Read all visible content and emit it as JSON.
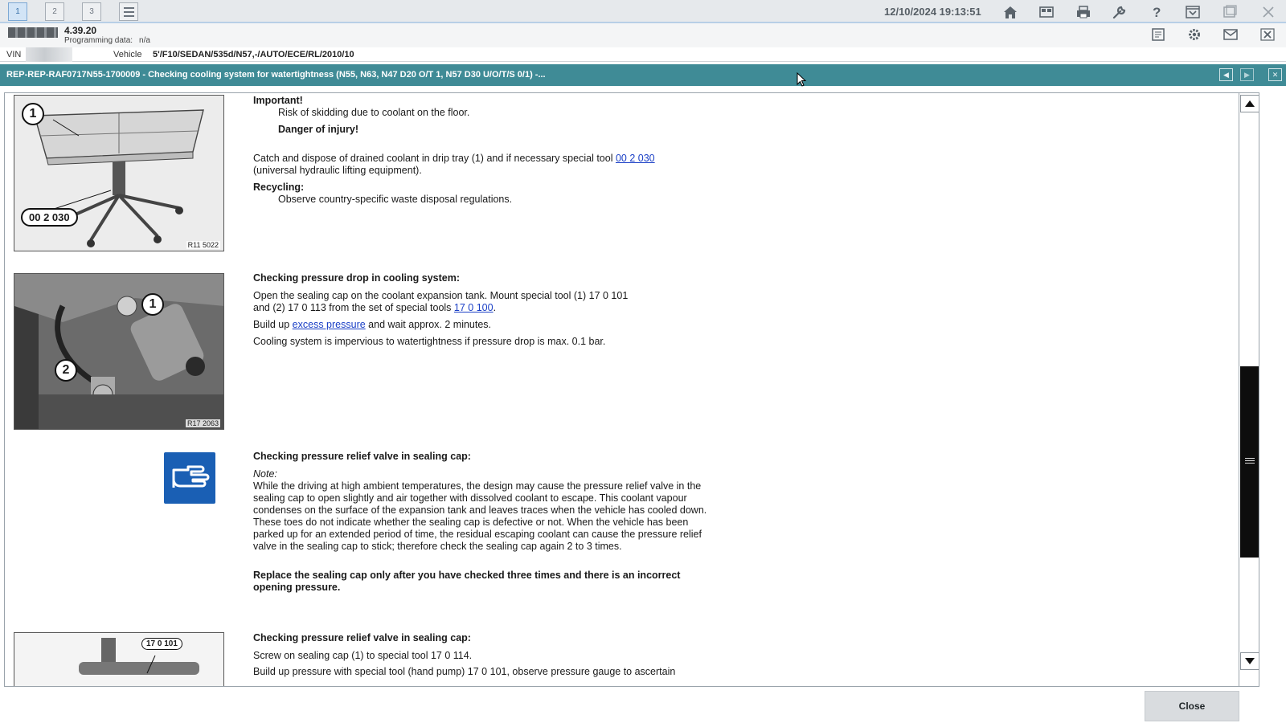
{
  "toolbar": {
    "tabs": [
      "1",
      "2",
      "3"
    ],
    "datetime": "12/10/2024 19:13:51"
  },
  "info": {
    "version": "4.39.20",
    "programming_label": "Programming data:",
    "programming_value": "n/a",
    "vin_label": "VIN",
    "vehicle_label": "Vehicle",
    "vehicle_value": "5'/F10/SEDAN/535d/N57,-/AUTO/ECE/RL/2010/10"
  },
  "document": {
    "title": "REP-REP-RAF0717N55-1700009 - Checking cooling system for watertightness (N55, N63, N47 D20 O/T 1, N57 D30 U/O/T/S 0/1) -...",
    "section1": {
      "important": "Important!",
      "risk": "Risk of skidding due to coolant on the floor.",
      "danger": "Danger of injury!",
      "catch_before": "Catch and dispose of drained coolant in drip tray (1) and if necessary special tool",
      "catch_link": "00 2 030",
      "catch_after": "(universal hydraulic lifting equipment).",
      "recycling": "Recycling:",
      "observe": "Observe country-specific waste disposal regulations.",
      "figure_code": "R11 5022",
      "callout_1": "1",
      "tool_label": "00 2 030"
    },
    "section2": {
      "heading": "Checking pressure drop in cooling system:",
      "line1": "Open the sealing cap on the coolant expansion tank. Mount special tool (1) 17 0 101",
      "line2_before": "and (2) 17 0 113  from the set of special tools",
      "line2_link": "17 0 100",
      "line2_after": ".",
      "line3_before": "Build up",
      "line3_link": "excess pressure",
      "line3_after": "and wait approx. 2 minutes.",
      "line4": "Cooling system is impervious to watertightness if pressure drop is max. 0.1 bar.",
      "figure_code": "R17 2063",
      "callout_1": "1",
      "callout_2": "2"
    },
    "section3": {
      "heading": "Checking pressure relief valve in sealing cap:",
      "note_label": "Note:",
      "note_text": "While the driving at high ambient temperatures, the design may cause the pressure relief valve in the sealing cap to open slightly and air together with dissolved coolant to escape. This coolant vapour condenses on the surface of the expansion tank and leaves traces when the vehicle has cooled down. These toes do not indicate whether the sealing cap is defective or not. When the vehicle has been parked up for an extended period of time, the residual escaping coolant can cause the pressure relief valve in the sealing cap to stick; therefore check the sealing cap again 2 to 3 times.",
      "replace": "Replace the sealing cap only after you have checked three times and there is an incorrect opening pressure."
    },
    "section4": {
      "heading": "Checking pressure relief valve in sealing cap:",
      "line1": "Screw on sealing cap (1) to special tool 17 0 114.",
      "line2": "Build up pressure with special tool (hand pump) 17 0 101, observe pressure gauge to ascertain",
      "tool_label": "17 0 101"
    }
  },
  "footer": {
    "close_label": "Close"
  },
  "icons": {
    "note": "pointing-hand-icon",
    "home": "home-icon",
    "help": "help-icon",
    "settings": "gear-icon",
    "tools": "wrench-icon"
  },
  "colors": {
    "titlebar": "#3f8b96",
    "link": "#1a3fc6",
    "note_icon": "#1a5fb4"
  }
}
